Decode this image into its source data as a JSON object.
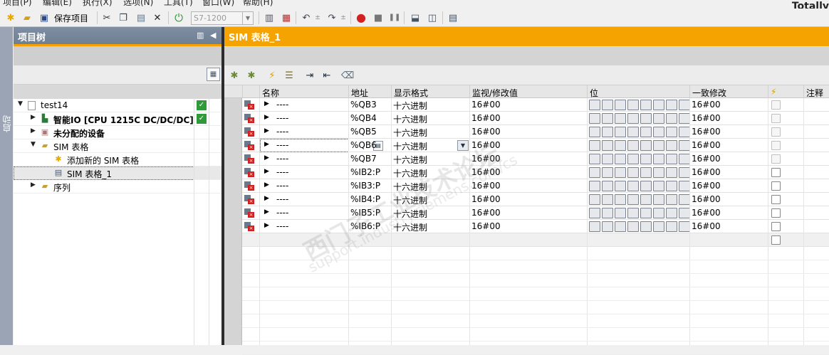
{
  "menu": {
    "items": [
      "项目(P)",
      "编辑(E)",
      "执行(X)",
      "选项(N)",
      "工具(T)",
      "窗口(W)",
      "帮助(H)"
    ],
    "brand": "Totally"
  },
  "toolbar": {
    "save_label": "保存项目",
    "cpu_select": "S7-1200"
  },
  "sidebar": {
    "label": "启动"
  },
  "project_tree": {
    "title": "项目树",
    "items": [
      {
        "label": "test14",
        "level": 0,
        "expanded": true,
        "status": "ok"
      },
      {
        "label": "智能IO [CPU 1215C DC/DC/DC]",
        "level": 1,
        "expanded": false,
        "status": "ok",
        "bold": true
      },
      {
        "label": "未分配的设备",
        "level": 1,
        "expanded": false,
        "bold": true
      },
      {
        "label": "SIM 表格",
        "level": 1,
        "expanded": true
      },
      {
        "label": "添加新的 SIM 表格",
        "level": 2
      },
      {
        "label": "SIM 表格_1",
        "level": 2,
        "selected": true
      },
      {
        "label": "序列",
        "level": 1,
        "expanded": false
      }
    ]
  },
  "editor": {
    "title": "SIM 表格_1",
    "columns": {
      "name": "名称",
      "address": "地址",
      "format": "显示格式",
      "monitor": "监视/修改值",
      "bits": "位",
      "consistent": "一致修改",
      "comment": "注释"
    },
    "rows": [
      {
        "name": "----",
        "address": "%QB3",
        "format": "十六进制",
        "monitor": "16#00",
        "consistent": "16#00",
        "checkbox_disabled": true
      },
      {
        "name": "----",
        "address": "%QB4",
        "format": "十六进制",
        "monitor": "16#00",
        "consistent": "16#00",
        "checkbox_disabled": true
      },
      {
        "name": "----",
        "address": "%QB5",
        "format": "十六进制",
        "monitor": "16#00",
        "consistent": "16#00",
        "checkbox_disabled": true
      },
      {
        "name": "----",
        "address": "%QB6",
        "format": "十六进制",
        "monitor": "16#00",
        "consistent": "16#00",
        "checkbox_disabled": true,
        "editing": true
      },
      {
        "name": "----",
        "address": "%QB7",
        "format": "十六进制",
        "monitor": "16#00",
        "consistent": "16#00",
        "checkbox_disabled": true
      },
      {
        "name": "----",
        "address": "%IB2:P",
        "format": "十六进制",
        "monitor": "16#00",
        "consistent": "16#00",
        "checkbox_disabled": false
      },
      {
        "name": "----",
        "address": "%IB3:P",
        "format": "十六进制",
        "monitor": "16#00",
        "consistent": "16#00",
        "checkbox_disabled": false
      },
      {
        "name": "----",
        "address": "%IB4:P",
        "format": "十六进制",
        "monitor": "16#00",
        "consistent": "16#00",
        "checkbox_disabled": false
      },
      {
        "name": "----",
        "address": "%IB5:P",
        "format": "十六进制",
        "monitor": "16#00",
        "consistent": "16#00",
        "checkbox_disabled": false
      },
      {
        "name": "----",
        "address": "%IB6:P",
        "format": "十六进制",
        "monitor": "16#00",
        "consistent": "16#00",
        "checkbox_disabled": false
      }
    ]
  },
  "watermark": {
    "line1": "西门子工业技术论坛",
    "line2": "support.industry.siemens.com/cs"
  },
  "colors": {
    "accent": "#f5a300",
    "tree_header": "#76869a",
    "ok_green": "#2e9a3a",
    "record_red": "#d02020"
  },
  "icons": {
    "check": "✓",
    "expand_collapsed": "▶",
    "expand_open": "▼",
    "dropdown": "▼",
    "record": "●",
    "stop": "■",
    "pause": "❚❚",
    "undo": "↶",
    "redo": "↷",
    "power": "⏻",
    "cut": "✂",
    "delete": "✕",
    "lightning": "⚡"
  }
}
